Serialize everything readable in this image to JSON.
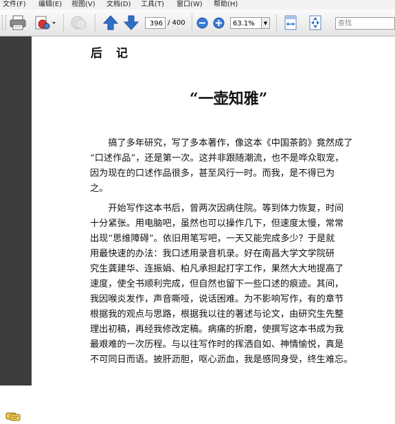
{
  "menu": {
    "items": [
      "文件(F)",
      "编辑(E)",
      "视图(V)",
      "文档(D)",
      "工具(T)",
      "窗口(W)",
      "帮助(H)"
    ]
  },
  "toolbar": {
    "page_current": "396",
    "page_total": "/ 400",
    "zoom_value": "63.1%",
    "search_placeholder": "查找"
  },
  "icons": {
    "print": "printer-icon",
    "share": "share-icon",
    "disabled": "review-icon",
    "prev": "arrow-up-icon",
    "next": "arrow-down-icon",
    "zoom_out": "zoom-out-icon",
    "zoom_in": "zoom-in-icon",
    "fit_page": "fit-page-icon",
    "fit_width": "fit-width-icon",
    "comment": "comment-icon"
  },
  "colors": {
    "left_panel": "#3d3d3d",
    "arrow_blue": "#2f6fc8",
    "zoom_blue": "#3a7bd5"
  },
  "document": {
    "heading": "后记",
    "title": "“一壶知雅”",
    "paragraph1": [
      "　　搞了多年研究，写了多本著作，像这本《中国茶韵》竟然成了",
      "“口述作品”，还是第一次。这并非跟随潮流，也不是哗众取宠，",
      "因为现在的口述作品很多，甚至风行一时。而我，是不得已为",
      "之。"
    ],
    "paragraph2": [
      "　　开始写作这本书后，曾两次因病住院。等到体力恢复，时间",
      "十分紧张。用电脑吧，虽然也可以操作几下，但速度太慢，常常",
      "出现“思维障碍”。依旧用笔写吧，一天又能完成多少？于是就",
      "用最快速的办法：我口述用录音机录。好在南昌大学文学院研",
      "究生龚建华、连振娟、柏凡承担起打字工作，果然大大地提高了",
      "速度，使全书顺利完成，但自然也留下一些口述的痕迹。其间，",
      "我因喉炎发作，声音嘶哑，说话困难。为不影响写作，有的章节",
      "根据我的观点与思路，根据我以往的著述与论文，由研究生先整",
      "理出初稿，再经我修改定稿。病痛的折磨，使撰写这本书成为我",
      "最艰难的一次历程。与以往写作时的挥洒自如、神情愉悦，真是",
      "不可同日而语。披肝沥胆，呕心沥血，我是感同身受，终生难忘。"
    ]
  }
}
